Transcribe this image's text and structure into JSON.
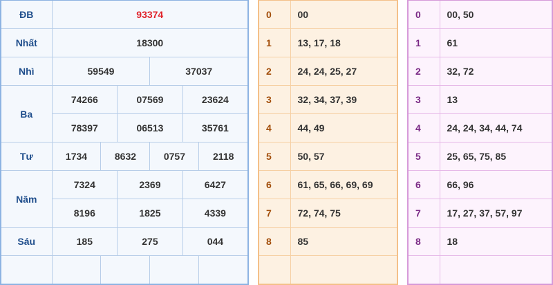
{
  "results": {
    "db": {
      "label": "ĐB",
      "value": "93374"
    },
    "nhat": {
      "label": "Nhất",
      "value": "18300"
    },
    "nhi": {
      "label": "Nhì",
      "values": [
        "59549",
        "37037"
      ]
    },
    "ba": {
      "label": "Ba",
      "values": [
        "74266",
        "07569",
        "23624",
        "78397",
        "06513",
        "35761"
      ]
    },
    "tu": {
      "label": "Tư",
      "values": [
        "1734",
        "8632",
        "0757",
        "2118"
      ]
    },
    "nam": {
      "label": "Năm",
      "values": [
        "7324",
        "2369",
        "6427",
        "8196",
        "1825",
        "4339"
      ]
    },
    "sau": {
      "label": "Sáu",
      "values": [
        "185",
        "275",
        "044"
      ]
    }
  },
  "head": [
    {
      "idx": "0",
      "nums": "00"
    },
    {
      "idx": "1",
      "nums": "13, 17, 18"
    },
    {
      "idx": "2",
      "nums": "24, 24, 25, 27"
    },
    {
      "idx": "3",
      "nums": "32, 34, 37, 39"
    },
    {
      "idx": "4",
      "nums": "44, 49"
    },
    {
      "idx": "5",
      "nums": "50, 57"
    },
    {
      "idx": "6",
      "nums": "61, 65, 66, 69, 69"
    },
    {
      "idx": "7",
      "nums": "72, 74, 75"
    },
    {
      "idx": "8",
      "nums": "85"
    }
  ],
  "tail": [
    {
      "idx": "0",
      "nums": "00, 50"
    },
    {
      "idx": "1",
      "nums": "61"
    },
    {
      "idx": "2",
      "nums": "32, 72"
    },
    {
      "idx": "3",
      "nums": "13"
    },
    {
      "idx": "4",
      "nums": "24, 24, 34, 44, 74"
    },
    {
      "idx": "5",
      "nums": "25, 65, 75, 85"
    },
    {
      "idx": "6",
      "nums": "66, 96"
    },
    {
      "idx": "7",
      "nums": "17, 27, 37, 57, 97"
    },
    {
      "idx": "8",
      "nums": "18"
    }
  ],
  "colors": {
    "special": "#e0242b",
    "prize_label": "#1f4e8c",
    "head_accent": "#f4c089",
    "tail_accent": "#d69ad9"
  }
}
